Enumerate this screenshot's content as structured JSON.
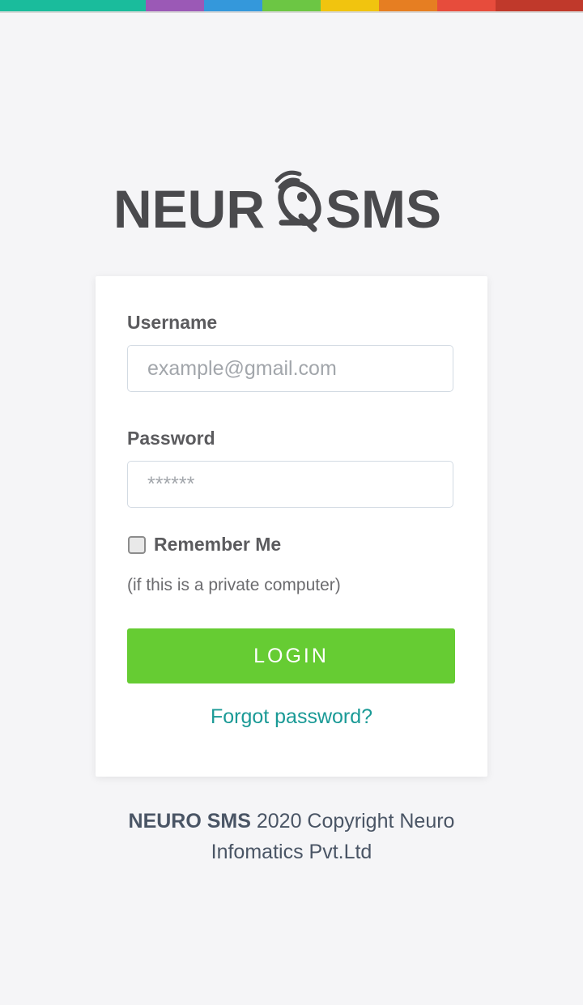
{
  "top_bar": {
    "segments": [
      {
        "color": "#1abc9c",
        "flex": 180
      },
      {
        "color": "#9b59b6",
        "flex": 72
      },
      {
        "color": "#3498db",
        "flex": 72
      },
      {
        "color": "#6cc644",
        "flex": 72
      },
      {
        "color": "#f1c40f",
        "flex": 72
      },
      {
        "color": "#e67e22",
        "flex": 72
      },
      {
        "color": "#e74c3c",
        "flex": 72
      },
      {
        "color": "#c0392b",
        "flex": 108
      }
    ]
  },
  "logo": {
    "text_left": "NEUR",
    "text_right": "SMS",
    "icon": "satellite-dish-icon",
    "color": "#4a4a4d"
  },
  "login_form": {
    "username_label": "Username",
    "username_placeholder": "example@gmail.com",
    "username_value": "",
    "password_label": "Password",
    "password_placeholder": "******",
    "password_value": "",
    "remember_label": "Remember Me",
    "remember_checked": false,
    "remember_hint": "(if this is a private computer)",
    "login_label": "LOGIN",
    "forgot_label": "Forgot password?"
  },
  "footer": {
    "brand": "NEURO SMS",
    "line1_rest": " 2020 Copyright Neuro",
    "line2": "Infomatics Pvt.Ltd"
  },
  "colors": {
    "accent_green": "#66cc33",
    "link_teal": "#1a9a96",
    "background": "#f5f5f7"
  }
}
